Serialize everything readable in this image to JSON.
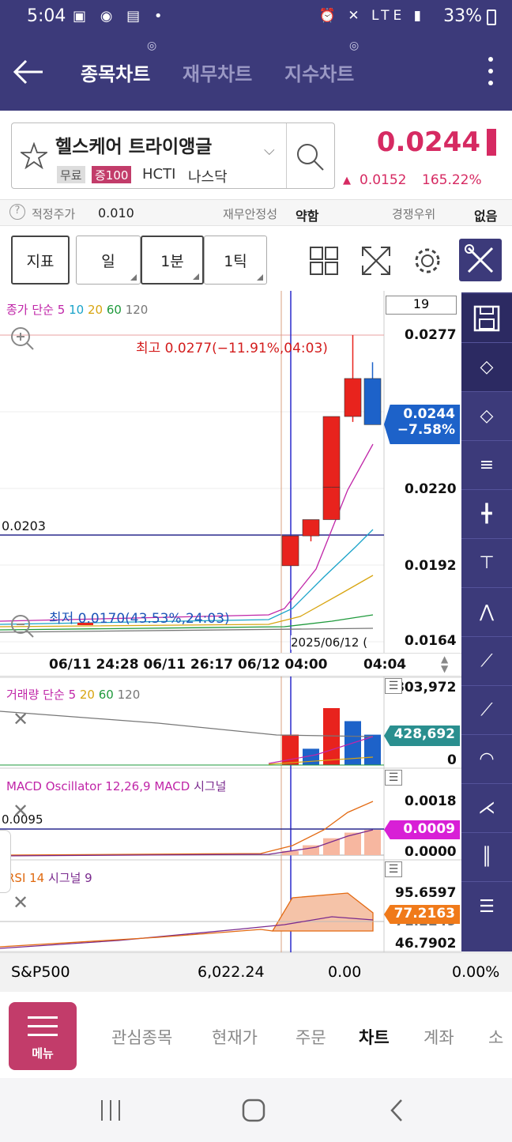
{
  "status": {
    "time": "5:04",
    "battery": "33%",
    "network": "LTE"
  },
  "header": {
    "tabs": [
      {
        "label": "종목차트",
        "active": true
      },
      {
        "label": "재무차트",
        "active": false
      },
      {
        "label": "지수차트",
        "active": false
      }
    ]
  },
  "stock": {
    "name": "헬스케어 트라이앵글",
    "tags": [
      "무료",
      "증100"
    ],
    "ticker": "HCTI",
    "market": "나스닥",
    "price": "0.0244",
    "change": "0.0152",
    "change_pct": "165.22%"
  },
  "info": {
    "fair_label": "적정주가",
    "fair_value": "0.010",
    "stability_label": "재무안정성",
    "stability_value": "약함",
    "competition_label": "경쟁우위",
    "competition_value": "없음"
  },
  "toolbar": {
    "indicator": "지표",
    "day": "일",
    "minute": "1분",
    "tick": "1틱"
  },
  "chart": {
    "period_box": "19",
    "ma_legend": {
      "prefix": "종가 단순",
      "p5": "5",
      "p10": "10",
      "p20": "20",
      "p60": "60",
      "p120": "120"
    },
    "high_label": "최고 0.0277(−11.91%,04:03)",
    "low_label": "최저 0.0170(43.53%,24:03)",
    "crosshair_price": "0.0203",
    "current_price": "0.0244",
    "current_pct": "−7.58%",
    "date_label": "2025/06/12 (",
    "price_ticks": [
      "0.0277",
      "0.0220",
      "0.0192",
      "0.0164"
    ],
    "time_axis": "06/11 24:28 06/11 26:17 06/12 04:00",
    "time_axis_right": "04:04"
  },
  "chart_data": {
    "type": "candlestick",
    "title": "",
    "ylim": [
      0.0164,
      0.0277
    ],
    "candles": [
      {
        "open": 0.0192,
        "high": 0.0203,
        "low": 0.0192,
        "close": 0.0203,
        "color": "up"
      },
      {
        "open": 0.0203,
        "high": 0.0209,
        "low": 0.0201,
        "close": 0.0209,
        "color": "up"
      },
      {
        "open": 0.0209,
        "high": 0.0222,
        "low": 0.0209,
        "close": 0.0221,
        "color": "up"
      },
      {
        "open": 0.0221,
        "high": 0.0247,
        "low": 0.022,
        "close": 0.0247,
        "color": "up"
      },
      {
        "open": 0.0247,
        "high": 0.0277,
        "low": 0.0245,
        "close": 0.0261,
        "color": "up"
      },
      {
        "open": 0.0261,
        "high": 0.0267,
        "low": 0.0244,
        "close": 0.0244,
        "color": "down"
      }
    ]
  },
  "volume": {
    "legend": {
      "prefix": "거래량 단순",
      "p5": "5",
      "p20": "20",
      "p60": "60",
      "p120": "120"
    },
    "ticks": [
      "803,972",
      "0"
    ],
    "current": "428,692",
    "bars": [
      430000,
      230000,
      300000,
      803972,
      620000,
      428692
    ]
  },
  "macd": {
    "legend": {
      "name": "MACD Oscillator 12,26,9",
      "macd": "MACD",
      "signal": "시그널"
    },
    "crosshair": "0.0095",
    "ticks": [
      "0.0018",
      "0.0000"
    ],
    "current": "0.0009",
    "bars": [
      0.00015,
      0.00035,
      0.0006,
      0.0008,
      0.0009,
      0.0009
    ]
  },
  "rsi": {
    "legend": {
      "name": "RSI 14",
      "signal": "시그널 9"
    },
    "ticks": [
      "95.6597",
      "71.2249",
      "46.7902"
    ],
    "current": "77.2163"
  },
  "index": {
    "name": "S&P500",
    "value": "6,022.24",
    "change": "0.00",
    "pct": "0.00%"
  },
  "bottom_nav": {
    "menu": "메뉴",
    "items": [
      {
        "label": "관심종목",
        "active": false
      },
      {
        "label": "현재가",
        "active": false
      },
      {
        "label": "주문",
        "active": false
      },
      {
        "label": "차트",
        "active": true
      },
      {
        "label": "계좌",
        "active": false
      },
      {
        "label": "소",
        "active": false
      }
    ]
  },
  "colors": {
    "header": "#3c3a7a",
    "up": "#e8231d",
    "down": "#1d62c9",
    "accent": "#d62a62",
    "menu": "#c23c6a"
  }
}
